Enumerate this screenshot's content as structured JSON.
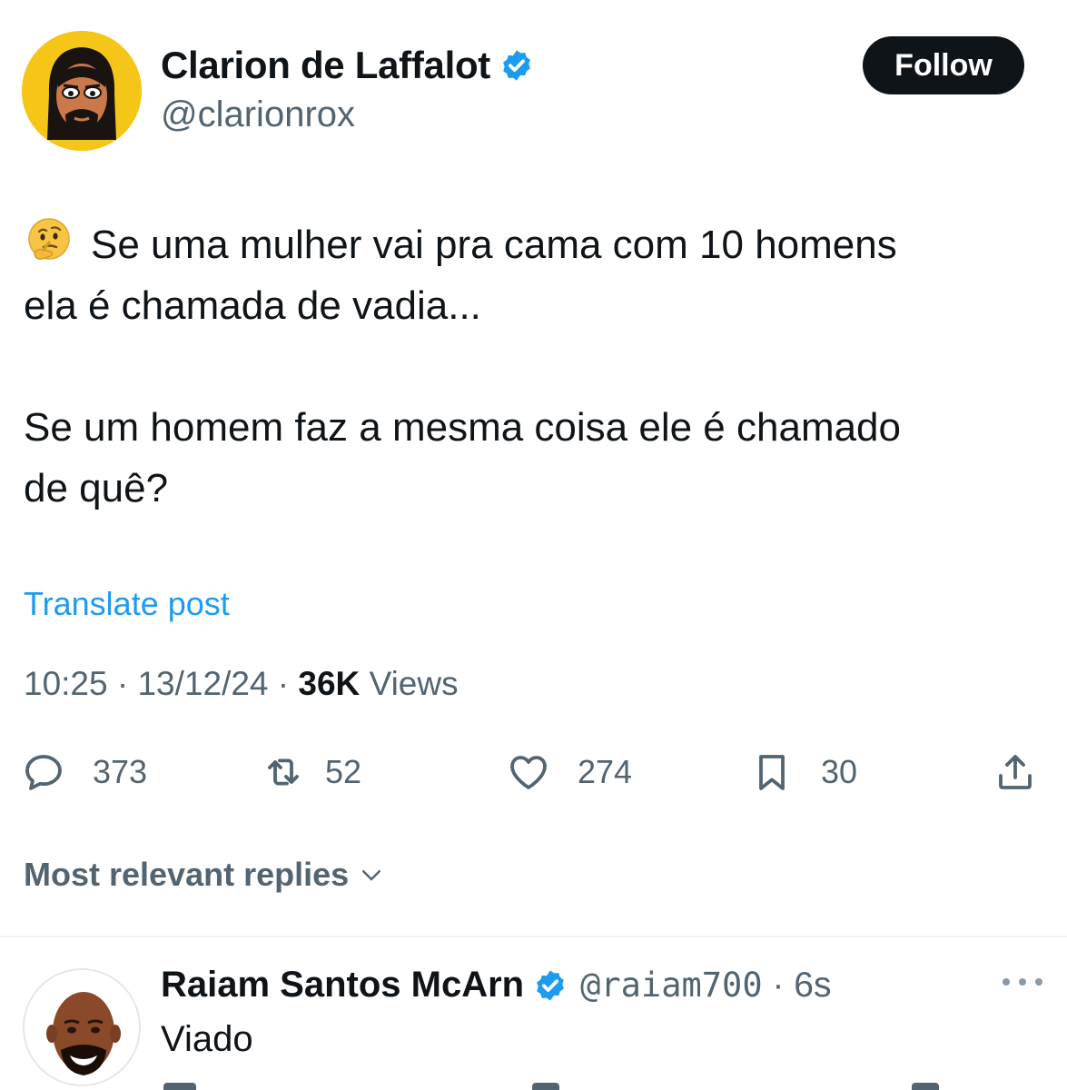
{
  "tweet": {
    "author": {
      "display_name": "Clarion de Laffalot",
      "handle": "@clarionrox",
      "verified": true,
      "avatar_icon": "cartoon-bearded-man-avatar"
    },
    "follow_label": "Follow",
    "emoji": "thinking-face-emoji",
    "text_lines": [
      "Se uma mulher vai pra cama com 10 homens",
      "ela é chamada de vadia...",
      "Se um homem faz a mesma coisa ele é chamado",
      "de quê?"
    ],
    "translate_label": "Translate post",
    "time": "10:25",
    "date": "13/12/24",
    "separator": "·",
    "views_count": "36K",
    "views_label": "Views",
    "actions": {
      "replies": "373",
      "reposts": "52",
      "likes": "274",
      "bookmarks": "30"
    }
  },
  "replies_sort_label": "Most relevant replies",
  "reply": {
    "display_name": "Raiam Santos McArn",
    "verified": true,
    "handle": "@raiam700",
    "time": "6s",
    "text": "Viado",
    "avatar_icon": "cartoon-bald-man-avatar"
  },
  "colors": {
    "text": "#0f1419",
    "secondary": "#536471",
    "accent": "#1d9bf0",
    "follow_bg": "#0f1419"
  }
}
